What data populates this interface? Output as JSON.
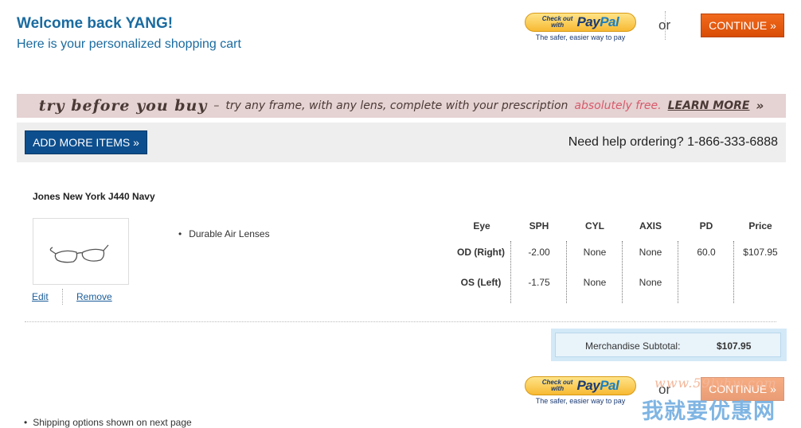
{
  "header": {
    "welcome": "Welcome back YANG!",
    "subtitle": "Here is your personalized shopping cart"
  },
  "paypal": {
    "check_out_line1": "Check out",
    "check_out_line2": "with",
    "logo_pay": "Pay",
    "logo_pal": "Pal",
    "tagline": "The safer, easier way to pay"
  },
  "checkout": {
    "or_label": "or",
    "continue_label": "CONTINUE »"
  },
  "promo": {
    "title": "try before you buy",
    "dash": "–",
    "text": "try any frame, with any lens, complete with your prescription",
    "free": "absolutely free.",
    "learn_more": "LEARN MORE",
    "arrow": "»",
    "colors": {
      "background": "#e5d2d2",
      "highlight": "#d75a6b"
    }
  },
  "toolbar": {
    "add_more": "ADD MORE ITEMS »",
    "help": "Need help ordering? 1-866-333-6888"
  },
  "item": {
    "name": "Jones New York J440 Navy",
    "edit": "Edit",
    "remove": "Remove",
    "lens": "Durable Air Lenses"
  },
  "prescription": {
    "headers": [
      "Eye",
      "SPH",
      "CYL",
      "AXIS",
      "PD",
      "Price"
    ],
    "rows": [
      {
        "eye": "OD (Right)",
        "sph": "-2.00",
        "cyl": "None",
        "axis": "None",
        "pd": "60.0",
        "price": "$107.95"
      },
      {
        "eye": "OS (Left)",
        "sph": "-1.75",
        "cyl": "None",
        "axis": "None",
        "pd": "",
        "price": ""
      }
    ]
  },
  "subtotal": {
    "label": "Merchandise Subtotal:",
    "value": "$107.95"
  },
  "watermark": {
    "url": "www.59lvhw.com",
    "cn": "我就要优惠网"
  },
  "footer": {
    "shipping_note": "Shipping options shown on next page"
  },
  "colors": {
    "brand_blue": "#1a6ba0",
    "continue_orange": "#e0560b",
    "add_more_navy": "#0d4f8e"
  }
}
